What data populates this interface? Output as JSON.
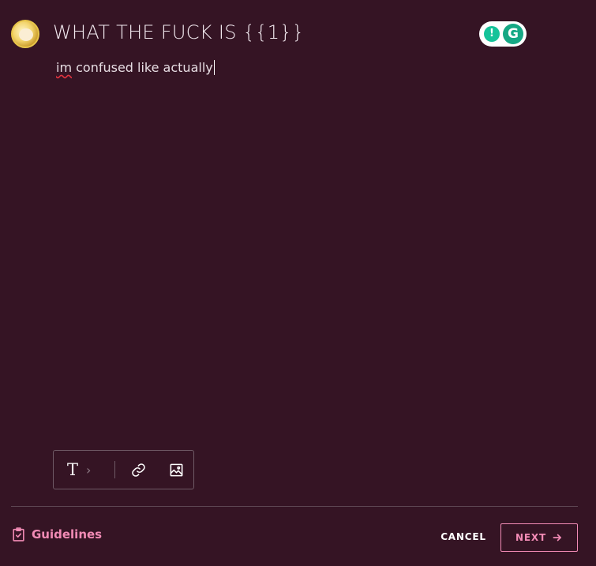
{
  "header": {
    "title": "WHAT THE FUCK IS {{1}}"
  },
  "editor": {
    "text_misspelled": "im",
    "text_rest": " confused like actually"
  },
  "toolbar": {
    "text_button_glyph": "T",
    "text_button_chevron": "›"
  },
  "grammarly": {
    "bulb_glyph": "!",
    "logo_glyph": "G"
  },
  "footer": {
    "guidelines_label": "Guidelines",
    "cancel_label": "CANCEL",
    "next_label": "NEXT"
  },
  "colors": {
    "background": "#351424",
    "accent": "#f28bb5",
    "grammarly_green": "#15c39a"
  },
  "icons": {
    "toolbar": [
      "text-format-icon",
      "chevron-right-icon",
      "link-icon",
      "image-icon"
    ],
    "footer": [
      "checklist-icon",
      "arrow-right-icon"
    ]
  }
}
